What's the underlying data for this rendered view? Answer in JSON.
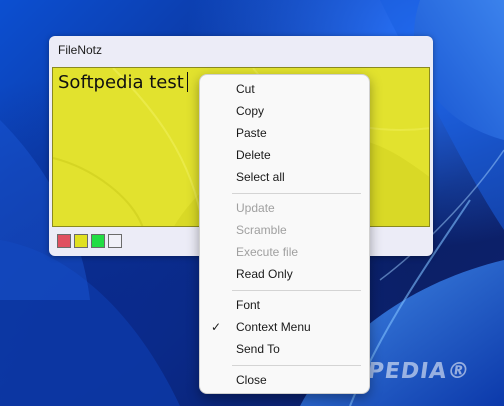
{
  "note_window": {
    "title": "FileNotz",
    "text": "Softpedia test",
    "background_color": "#e2e22e",
    "swatches": [
      {
        "name": "red",
        "color": "#e05060"
      },
      {
        "name": "yellow",
        "color": "#e0e020"
      },
      {
        "name": "green",
        "color": "#22dd44"
      },
      {
        "name": "white",
        "color": "#f0f0f8"
      }
    ]
  },
  "context_menu": {
    "items": [
      {
        "label": "Cut",
        "enabled": true,
        "checked": false
      },
      {
        "label": "Copy",
        "enabled": true,
        "checked": false
      },
      {
        "label": "Paste",
        "enabled": true,
        "checked": false
      },
      {
        "label": "Delete",
        "enabled": true,
        "checked": false
      },
      {
        "label": "Select all",
        "enabled": true,
        "checked": false
      },
      {
        "label": "Update",
        "enabled": false,
        "checked": false
      },
      {
        "label": "Scramble",
        "enabled": false,
        "checked": false
      },
      {
        "label": "Execute file",
        "enabled": false,
        "checked": false
      },
      {
        "label": "Read Only",
        "enabled": true,
        "checked": false
      },
      {
        "label": "Font",
        "enabled": true,
        "checked": false
      },
      {
        "label": "Context Menu",
        "enabled": true,
        "checked": true
      },
      {
        "label": "Send To",
        "enabled": true,
        "checked": false
      },
      {
        "label": "Close",
        "enabled": true,
        "checked": false
      }
    ],
    "check_glyph": "✓"
  },
  "watermark": "SOFTPEDIA®"
}
